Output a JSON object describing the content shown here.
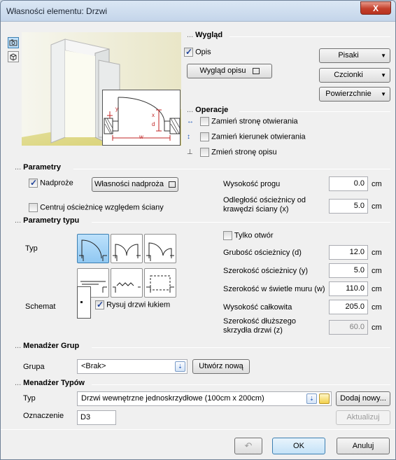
{
  "window": {
    "title": "Własności elementu: Drzwi",
    "close": "X"
  },
  "wyglad": {
    "title": "Wygląd",
    "opis_label": "Opis",
    "opis_checked": true,
    "wyglad_opisu_button": "Wygląd opisu",
    "pisaki": "Pisaki",
    "czcionki": "Czcionki",
    "powierzchnie": "Powierzchnie"
  },
  "operacje": {
    "title": "Operacje",
    "items": [
      "Zamień stronę otwierania",
      "Zamień kierunek otwierania",
      "Zmień stronę opisu"
    ]
  },
  "preview": {
    "label_y": "y",
    "label_x": "x",
    "label_d": "d",
    "label_w": "w"
  },
  "parametry": {
    "title": "Parametry",
    "nadproze_label": "Nadproże",
    "nadproze_checked": true,
    "wlasnosci_nadproza_button": "Własności nadproża",
    "centruj_label": "Centruj ościeżnicę względem ściany",
    "wysokosc_progu_label": "Wysokość progu",
    "wysokosc_progu_value": "0.0",
    "odleglosc_label": "Odległość ościeżnicy od krawędzi ściany (x)",
    "odleglosc_value": "5.0",
    "unit": "cm"
  },
  "parametry_typu": {
    "title": "Parametry typu",
    "typ_label": "Typ",
    "schemat_label": "Schemat",
    "rysuj_label": "Rysuj drzwi łukiem",
    "rysuj_checked": true,
    "tylko_otwor_label": "Tylko otwór",
    "fields": [
      {
        "label": "Grubość ościeżnicy (d)",
        "value": "12.0",
        "unit": "cm"
      },
      {
        "label": "Szerokość ościeżnicy (y)",
        "value": "5.0",
        "unit": "cm"
      },
      {
        "label": "Szerokość w świetle muru (w)",
        "value": "110.0",
        "unit": "cm"
      },
      {
        "label": "Wysokość całkowita",
        "value": "205.0",
        "unit": "cm"
      }
    ],
    "dluzsze_label": "Szerokość dłuższego skrzydła drzwi (z)",
    "dluzsze_value": "60.0",
    "dluzsze_unit": "cm"
  },
  "menadzer_grup": {
    "title": "Menadżer Grup",
    "grupa_label": "Grupa",
    "grupa_value": "<Brak>",
    "utworz_button": "Utwórz nową"
  },
  "menadzer_typow": {
    "title": "Menadżer Typów",
    "typ_label": "Typ",
    "typ_value": "Drzwi wewnętrzne jednoskrzydłowe (100cm x 200cm)",
    "dodaj_button": "Dodaj nowy...",
    "oznaczenie_label": "Oznaczenie",
    "oznaczenie_value": "D3",
    "aktualizuj_button": "Aktualizuj"
  },
  "footer": {
    "ok": "OK",
    "anuluj": "Anuluj"
  },
  "colors": {
    "accent": "#3c7fb1",
    "selected_fill": "#a8d4f5",
    "title_bar": "#c4d5ea"
  }
}
